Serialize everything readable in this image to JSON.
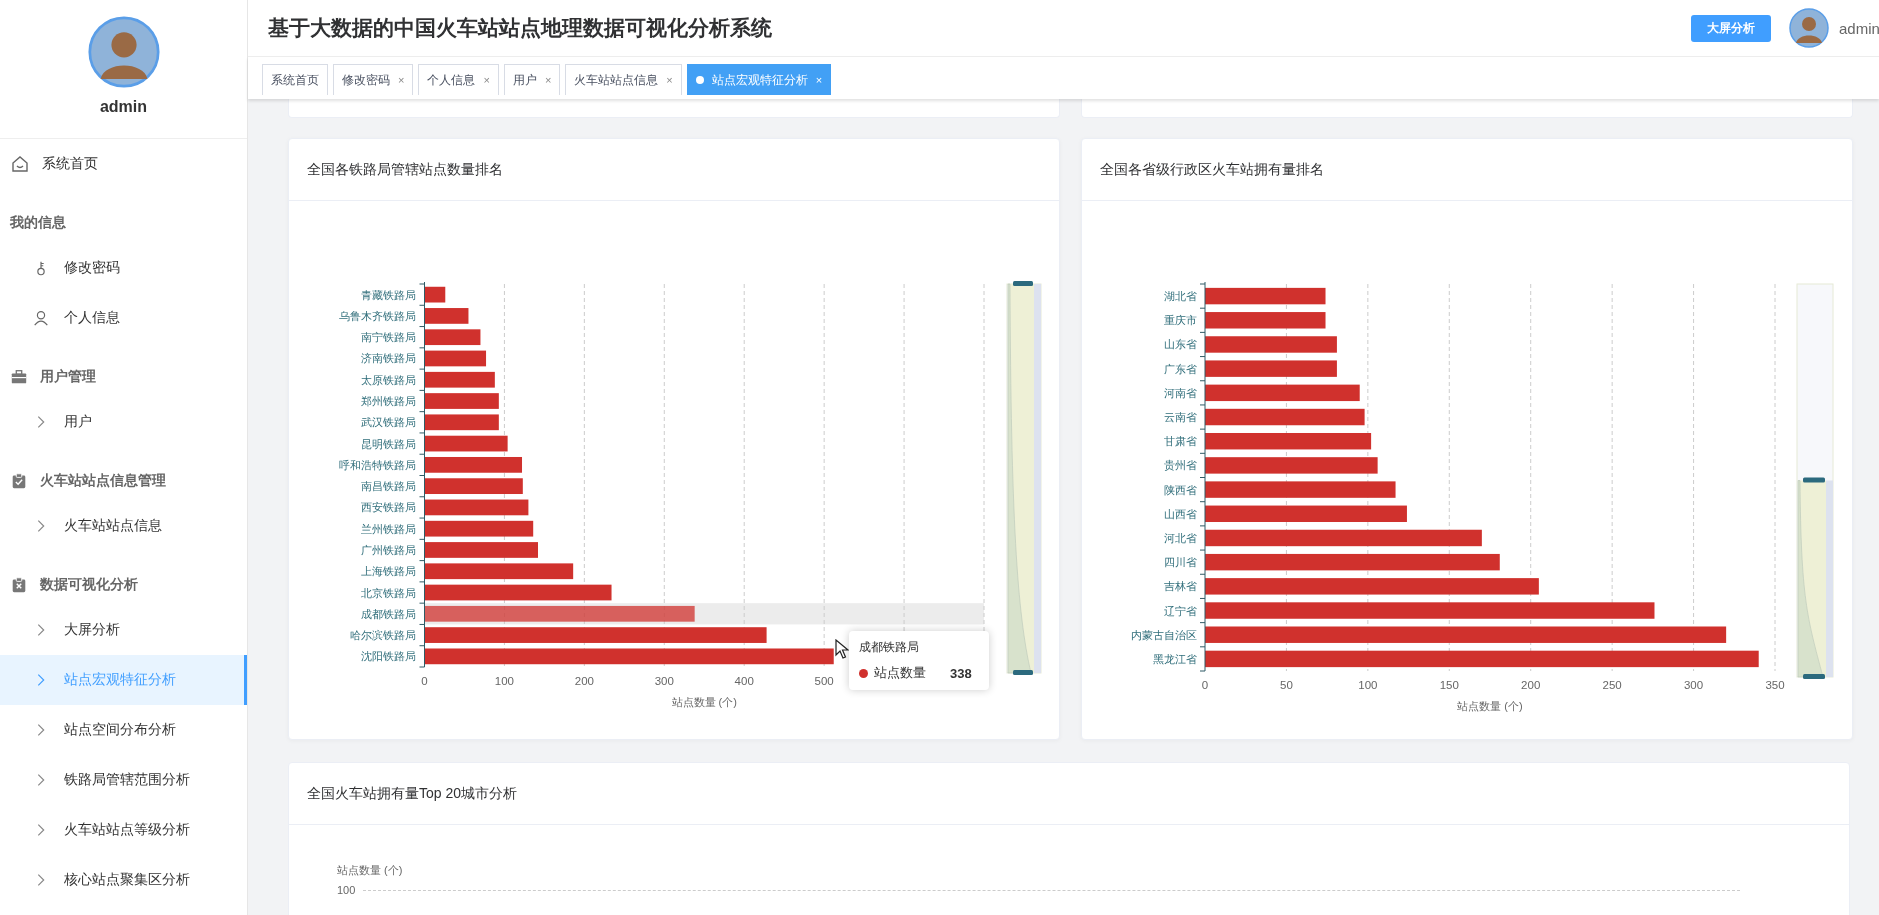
{
  "header": {
    "title": "基于大数据的中国火车站站点地理数据可视化分析系统",
    "screen_button": "大屏分析",
    "user": "admin"
  },
  "sidebar": {
    "user": "admin",
    "menu": [
      {
        "kind": "link",
        "label": "系统首页",
        "selected": false
      },
      {
        "kind": "group",
        "label": "我的信息",
        "children": [
          {
            "label": "修改密码",
            "selected": false
          },
          {
            "label": "个人信息",
            "selected": false
          }
        ]
      },
      {
        "kind": "group",
        "label": "用户管理",
        "children": [
          {
            "label": "用户",
            "selected": false
          }
        ]
      },
      {
        "kind": "group",
        "label": "火车站站点信息管理",
        "children": [
          {
            "label": "火车站站点信息",
            "selected": false
          }
        ]
      },
      {
        "kind": "group",
        "label": "数据可视化分析",
        "children": [
          {
            "label": "大屏分析",
            "selected": false
          },
          {
            "label": "站点宏观特征分析",
            "selected": true
          },
          {
            "label": "站点空间分布分析",
            "selected": false
          },
          {
            "label": "铁路局管辖范围分析",
            "selected": false
          },
          {
            "label": "火车站站点等级分析",
            "selected": false
          },
          {
            "label": "核心站点聚集区分析",
            "selected": false
          }
        ]
      }
    ]
  },
  "tabs": [
    {
      "label": "系统首页",
      "selected": false
    },
    {
      "label": "修改密码",
      "selected": false,
      "close": "×"
    },
    {
      "label": "个人信息",
      "selected": false,
      "close": "×"
    },
    {
      "label": "用户",
      "selected": false,
      "close": "×"
    },
    {
      "label": "火车站站点信息",
      "selected": false,
      "close": "×"
    },
    {
      "label": "站点宏观特征分析",
      "selected": true,
      "close": "×"
    }
  ],
  "panels": [
    {
      "title": "全国各铁路局管辖站点数量排名",
      "chart_data": {
        "type": "bar",
        "orientation": "horizontal",
        "xlabel": "站点数量 (个)",
        "categories": [
          "青藏铁路局",
          "乌鲁木齐铁路局",
          "南宁铁路局",
          "济南铁路局",
          "太原铁路局",
          "郑州铁路局",
          "武汉铁路局",
          "昆明铁路局",
          "呼和浩特铁路局",
          "南昌铁路局",
          "西安铁路局",
          "兰州铁路局",
          "广州铁路局",
          "上海铁路局",
          "北京铁路局",
          "成都铁路局",
          "哈尔滨铁路局",
          "沈阳铁路局"
        ],
        "series": [
          {
            "name": "站点数量",
            "color": "#d0312d",
            "values": [
              26,
              55,
              70,
              77,
              88,
              93,
              93,
              104,
              122,
              123,
              130,
              136,
              142,
              186,
              234,
              338,
              428,
              512
            ]
          }
        ],
        "xlim": [
          0,
          700
        ],
        "xticks": [
          0,
          100,
          200,
          300,
          400,
          500
        ],
        "grid": true
      },
      "hovered": [
        false,
        false,
        false,
        false,
        false,
        false,
        false,
        false,
        false,
        false,
        false,
        false,
        false,
        false,
        false,
        true,
        false,
        false
      ],
      "tooltip": {
        "title": "成都铁路局",
        "value": "338"
      }
    },
    {
      "title": "全国各省级行政区火车站拥有量排名",
      "chart_data": {
        "type": "bar",
        "orientation": "horizontal",
        "xlabel": "站点数量 (个)",
        "categories": [
          "湖北省",
          "重庆市",
          "山东省",
          "广东省",
          "河南省",
          "云南省",
          "甘肃省",
          "贵州省",
          "陕西省",
          "山西省",
          "河北省",
          "四川省",
          "吉林省",
          "辽宁省",
          "内蒙古自治区",
          "黑龙江省"
        ],
        "series": [
          {
            "color": "#d0312d",
            "values": [
              74,
              74,
              81,
              81,
              95,
              98,
              102,
              106,
              117,
              124,
              170,
              181,
              205,
              276,
              320,
              340
            ]
          }
        ],
        "xlim": [
          0,
          350
        ],
        "xticks": [
          0,
          50,
          100,
          150,
          200,
          250,
          300,
          350
        ],
        "grid": true
      }
    }
  ],
  "top20_panel": {
    "title": "全国火车站拥有量Top 20城市分析",
    "y_axis_name": "站点数量 (个)",
    "y_tick": "100"
  }
}
